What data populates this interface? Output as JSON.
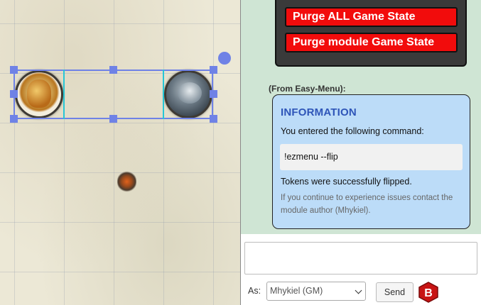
{
  "macros": {
    "purge_all": "Purge ALL Game State",
    "purge_module": "Purge module Game State"
  },
  "message": {
    "from": "(From Easy-Menu):",
    "title": "INFORMATION",
    "intro": "You entered the following command:",
    "command": "!ezmenu --flip",
    "result": "Tokens were successfully flipped.",
    "footnote": "If you continue to experience issues contact the module author (Mhykiel)."
  },
  "input": {
    "as_label": "As:",
    "speaking_as": "Mhykiel (GM)",
    "send_label": "Send",
    "icon_letter": "B"
  },
  "colors": {
    "selection": "#6f82e6",
    "danger": "#f20c0c",
    "info_title": "#2e55b8",
    "chat_bg": "#cfe5d4",
    "card_bg": "#bcdcf8"
  },
  "icons": [
    "rotate-handle-icon",
    "chevron-down-icon",
    "b-hexagon-icon"
  ]
}
